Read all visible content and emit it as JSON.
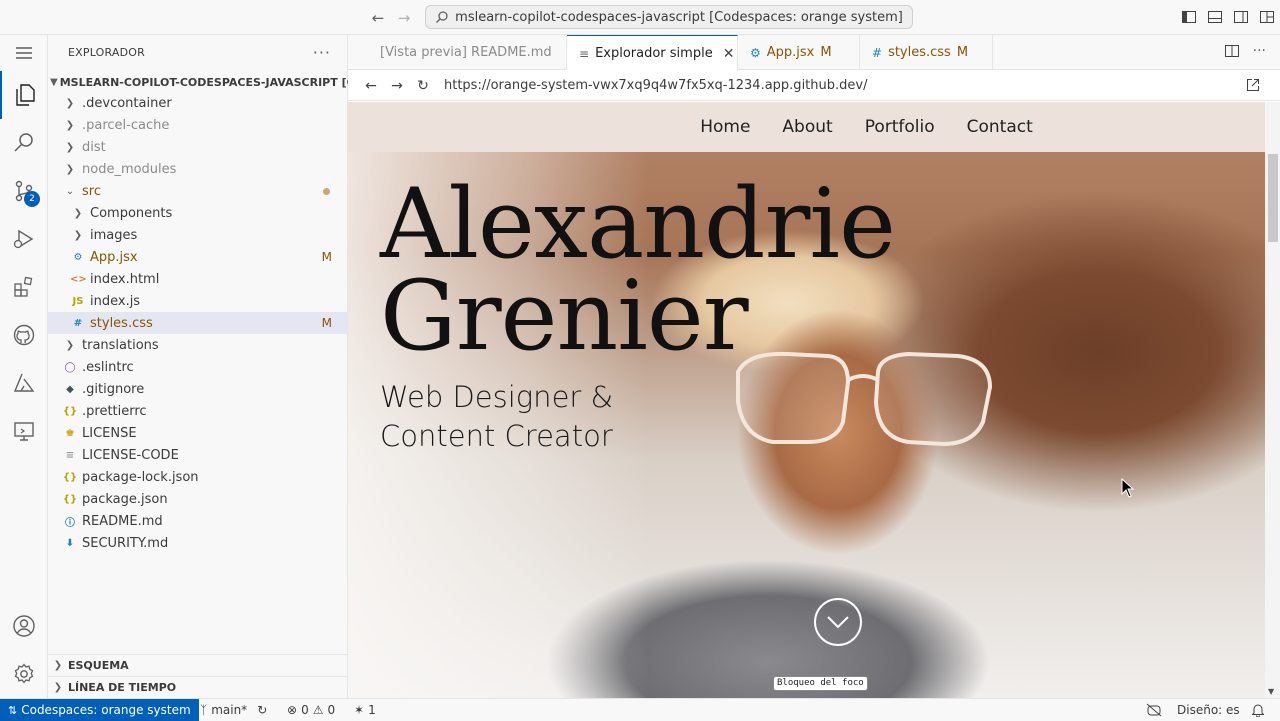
{
  "titlebar": {
    "command_center": "mslearn-copilot-codespaces-javascript [Codespaces: orange system]"
  },
  "activity_bar": {
    "scm_badge": "2"
  },
  "sidebar": {
    "title": "EXPLORADOR",
    "more": "···",
    "folder_name": "MSLEARN-COPILOT-CODESPACES-JAVASCRIPT [CO...",
    "items": [
      {
        "label": ".devcontainer"
      },
      {
        "label": ".parcel-cache"
      },
      {
        "label": "dist"
      },
      {
        "label": "node_modules"
      },
      {
        "label": "src"
      },
      {
        "label": "Components"
      },
      {
        "label": "images"
      },
      {
        "label": "App.jsx",
        "badge": "M"
      },
      {
        "label": "index.html"
      },
      {
        "label": "index.js"
      },
      {
        "label": "styles.css",
        "badge": "M"
      },
      {
        "label": "translations"
      },
      {
        "label": ".eslintrc"
      },
      {
        "label": ".gitignore"
      },
      {
        "label": ".prettierrc"
      },
      {
        "label": "LICENSE"
      },
      {
        "label": "LICENSE-CODE"
      },
      {
        "label": "package-lock.json"
      },
      {
        "label": "package.json"
      },
      {
        "label": "README.md"
      },
      {
        "label": "SECURITY.md"
      }
    ],
    "sections": [
      "ESQUEMA",
      "LÍNEA DE TIEMPO"
    ]
  },
  "tabs": [
    {
      "label": "[Vista previa] README.md"
    },
    {
      "label": "Explorador simple"
    },
    {
      "label": "App.jsx",
      "badge": "M"
    },
    {
      "label": "styles.css",
      "badge": "M"
    }
  ],
  "browser": {
    "url": "https://orange-system-vwx7xq9q4w7fx5xq-1234.app.github.dev/"
  },
  "site": {
    "nav": [
      "Home",
      "About",
      "Portfolio",
      "Contact"
    ],
    "name_line1": "Alexandrie",
    "name_line2": "Grenier",
    "subtitle_line1": "Web Designer &",
    "subtitle_line2": "Content Creator",
    "focus_tooltip": "Bloqueo del foco"
  },
  "statusbar": {
    "remote": "Codespaces: orange system",
    "branch": "main*",
    "errors": "0",
    "warnings": "0",
    "ports": "1",
    "layout": "Diseño: es"
  },
  "colors": {
    "accent": "#005fb8",
    "modified": "#895503"
  }
}
